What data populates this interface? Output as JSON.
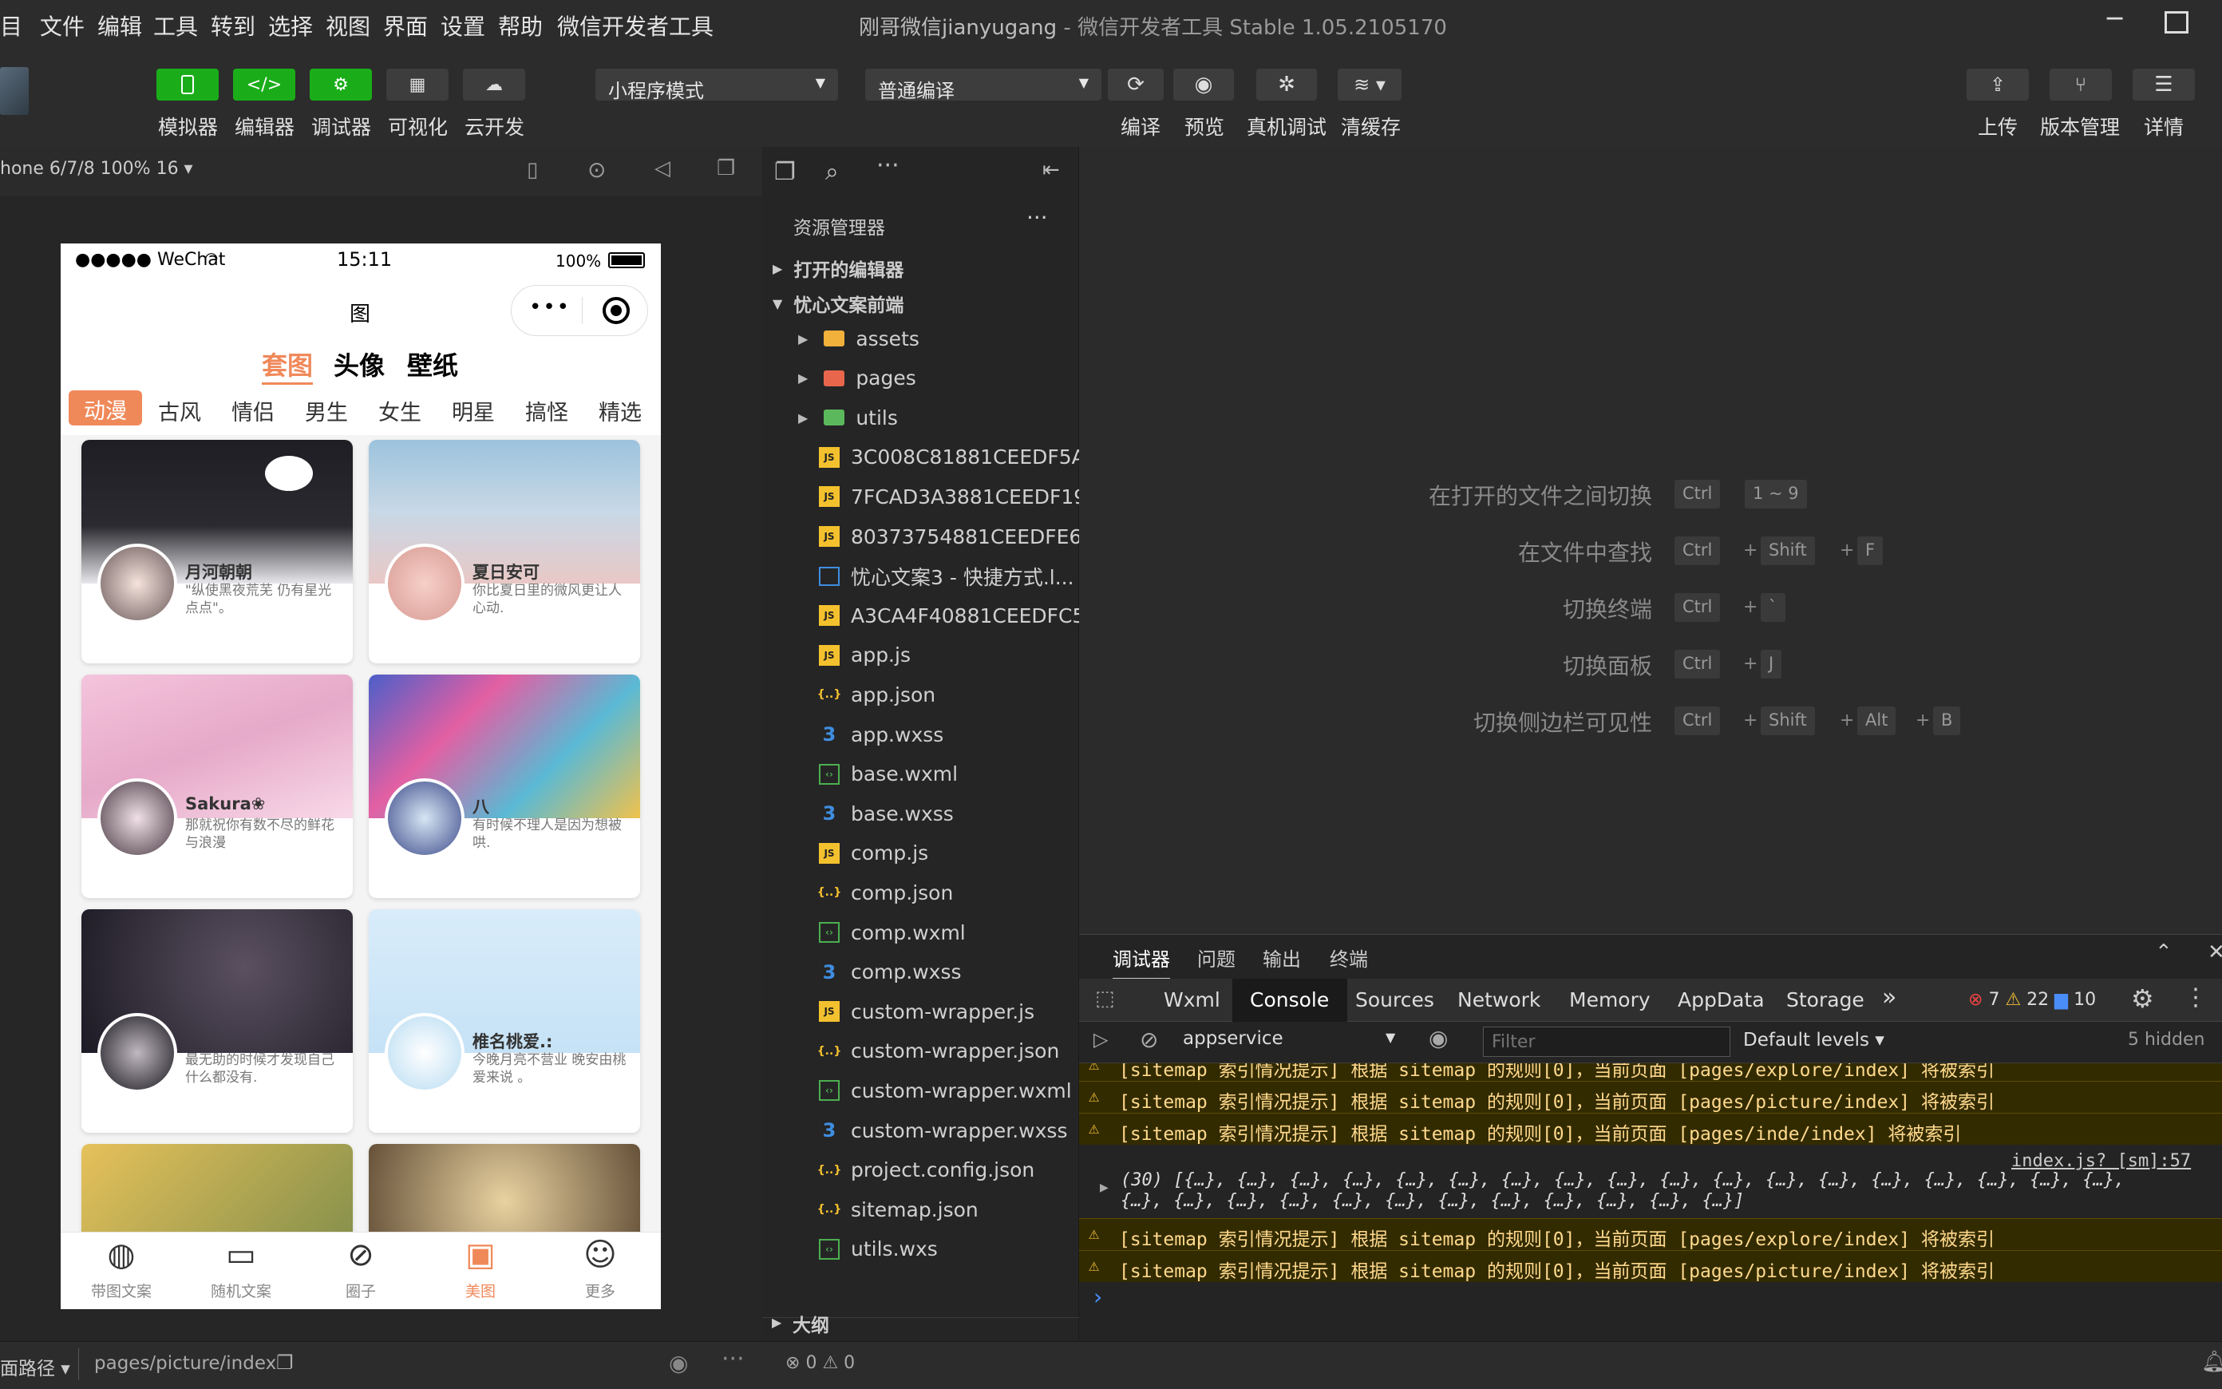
{
  "menubar": {
    "items": [
      "目",
      "文件",
      "编辑",
      "工具",
      "转到",
      "选择",
      "视图",
      "界面",
      "设置",
      "帮助",
      "微信开发者工具"
    ],
    "title": "刚哥微信jianyugang",
    "title_sep": " - ",
    "title_app": "微信开发者工具 Stable 1.05.2105170"
  },
  "toolbar": {
    "left_buttons": [
      "模拟器",
      "编辑器",
      "调试器",
      "可视化",
      "云开发"
    ],
    "mode_select": "小程序模式",
    "compile_select": "普通编译",
    "center_buttons": [
      "编译",
      "预览",
      "真机调试",
      "清缓存"
    ],
    "right_buttons": [
      "上传",
      "版本管理",
      "详情"
    ]
  },
  "simulator": {
    "device": "hone 6/7/8 100% 16 ▾",
    "status": {
      "carrier": "●●●●● WeChat",
      "time": "15:11",
      "battery": "100%"
    },
    "page_title": "图",
    "top_tabs": [
      "套图",
      "头像",
      "壁纸"
    ],
    "active_top_tab": "套图",
    "categories": [
      "动漫",
      "古风",
      "情侣",
      "男生",
      "女生",
      "明星",
      "搞怪",
      "精选"
    ],
    "active_category": "动漫",
    "cards": [
      {
        "name": "月河朝朝",
        "desc": "\"纵使黑夜荒芜 仍有星光点点\"。"
      },
      {
        "name": "夏日安可",
        "desc": "你比夏日里的微风更让人心动."
      },
      {
        "name": "Sakura❀",
        "desc": "那就祝你有数不尽的鲜花与浪漫"
      },
      {
        "name": "八",
        "desc": "有时候不理人是因为想被哄."
      },
      {
        "name": "",
        "desc": "最无助的时候才发现自己什么都没有."
      },
      {
        "name": "椎名桃爱.:",
        "desc": "今晚月亮不营业 晚安由桃爱来说 。"
      }
    ],
    "tabbar": [
      "带图文案",
      "随机文案",
      "圈子",
      "美图",
      "更多"
    ],
    "active_tab": "美图"
  },
  "explorer": {
    "title": "资源管理器",
    "open_editors": "打开的编辑器",
    "project": "忧心文案前端",
    "files": [
      {
        "name": "assets",
        "type": "folder"
      },
      {
        "name": "pages",
        "type": "folder"
      },
      {
        "name": "utils",
        "type": "folder"
      },
      {
        "name": "3C008C81881CEEDF5A...",
        "type": "js"
      },
      {
        "name": "7FCAD3A3881CEEDF19...",
        "type": "js"
      },
      {
        "name": "80373754881CEEDFE6...",
        "type": "js"
      },
      {
        "name": "忧心文案3 - 快捷方式.l...",
        "type": "file"
      },
      {
        "name": "A3CA4F40881CEEDFC5...",
        "type": "js"
      },
      {
        "name": "app.js",
        "type": "js"
      },
      {
        "name": "app.json",
        "type": "json"
      },
      {
        "name": "app.wxss",
        "type": "wxss"
      },
      {
        "name": "base.wxml",
        "type": "wxml"
      },
      {
        "name": "base.wxss",
        "type": "wxss"
      },
      {
        "name": "comp.js",
        "type": "js"
      },
      {
        "name": "comp.json",
        "type": "json"
      },
      {
        "name": "comp.wxml",
        "type": "wxml"
      },
      {
        "name": "comp.wxss",
        "type": "wxss"
      },
      {
        "name": "custom-wrapper.js",
        "type": "js"
      },
      {
        "name": "custom-wrapper.json",
        "type": "json"
      },
      {
        "name": "custom-wrapper.wxml",
        "type": "wxml"
      },
      {
        "name": "custom-wrapper.wxss",
        "type": "wxss"
      },
      {
        "name": "project.config.json",
        "type": "json"
      },
      {
        "name": "sitemap.json",
        "type": "json"
      },
      {
        "name": "utils.wxs",
        "type": "wxml"
      }
    ],
    "outline": "大纲"
  },
  "shortcuts": [
    {
      "label": "在打开的文件之间切换",
      "keys": [
        "Ctrl",
        "1 ~ 9"
      ],
      "sep": [
        ""
      ]
    },
    {
      "label": "在文件中查找",
      "keys": [
        "Ctrl",
        "Shift",
        "F"
      ],
      "sep": [
        "+",
        "+"
      ]
    },
    {
      "label": "切换终端",
      "keys": [
        "Ctrl",
        "`"
      ],
      "sep": [
        "+"
      ]
    },
    {
      "label": "切换面板",
      "keys": [
        "Ctrl",
        "J"
      ],
      "sep": [
        "+"
      ]
    },
    {
      "label": "切换侧边栏可见性",
      "keys": [
        "Ctrl",
        "Shift",
        "Alt",
        "B"
      ],
      "sep": [
        "+",
        "+",
        "+"
      ]
    }
  ],
  "debug": {
    "tabs": [
      "调试器",
      "问题",
      "输出",
      "终端"
    ],
    "devtools_tabs": [
      "Wxml",
      "Console",
      "Sources",
      "Network",
      "Memory",
      "AppData",
      "Storage"
    ],
    "active_devtools_tab": "Console",
    "more": "»",
    "errors": "7",
    "warnings": "22",
    "infos": "10",
    "context": "appservice",
    "filter_placeholder": "Filter",
    "levels": "Default levels ▾",
    "hidden": "5 hidden",
    "logs": [
      "[sitemap 索引情况提示] 根据 sitemap 的规则[0]，当前页面 [pages/explore/index] 将被索引",
      "[sitemap 索引情况提示] 根据 sitemap 的规则[0]，当前页面 [pages/picture/index] 将被索引",
      "[sitemap 索引情况提示] 根据 sitemap 的规则[0]，当前页面 [pages/inde/index] 将被索引"
    ],
    "source_link": "index.js? [sm]:57",
    "array_line1": "(30) [{…}, {…}, {…}, {…}, {…}, {…}, {…}, {…}, {…}, {…}, {…}, {…}, {…}, {…}, {…}, {…}, {…}, {…},",
    "array_line2": "{…}, {…}, {…}, {…}, {…}, {…}, {…}, {…}, {…}, {…}, {…}, {…}]",
    "logs2": [
      "[sitemap 索引情况提示] 根据 sitemap 的规则[0]，当前页面 [pages/explore/index] 将被索引",
      "[sitemap 索引情况提示] 根据 sitemap 的规则[0]，当前页面 [pages/picture/index] 将被索引"
    ],
    "prompt": "›"
  },
  "statusbar": {
    "path_label": "面路径 ▾",
    "path": "pages/picture/index",
    "errors": "0",
    "warnings": "0"
  }
}
